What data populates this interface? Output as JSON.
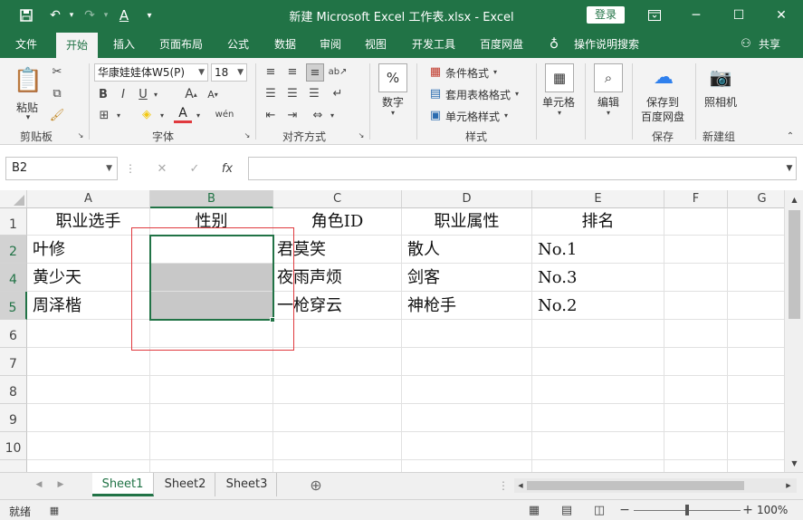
{
  "titlebar": {
    "title": "新建 Microsoft Excel 工作表.xlsx  -  Excel",
    "login_label": "登录"
  },
  "ribbon_tabs": [
    "文件",
    "开始",
    "插入",
    "页面布局",
    "公式",
    "数据",
    "审阅",
    "视图",
    "开发工具",
    "百度网盘",
    "操作说明搜索",
    "共享"
  ],
  "ribbon": {
    "paste_label": "粘贴",
    "clipboard_group": "剪贴板",
    "font_name": "华康娃娃体W5(P)",
    "font_size": "18",
    "font_group": "字体",
    "bold": "B",
    "italic": "I",
    "underline": "U",
    "align_group": "对齐方式",
    "number_label": "数字",
    "conditional_format": "条件格式",
    "table_format": "套用表格格式",
    "cell_style": "单元格样式",
    "style_group": "样式",
    "cells_label": "单元格",
    "edit_label": "编辑",
    "save_baidu_line1": "保存到",
    "save_baidu_line2": "百度网盘",
    "save_group": "保存",
    "camera_label": "照相机",
    "new_group": "新建组"
  },
  "formula_bar": {
    "name_box": "B2",
    "fx": "fx",
    "formula": ""
  },
  "columns": [
    "A",
    "B",
    "C",
    "D",
    "E",
    "F",
    "G"
  ],
  "rows": [
    "1",
    "2",
    "4",
    "5",
    "6",
    "7",
    "8",
    "9",
    "10"
  ],
  "cells": {
    "r1": [
      "职业选手",
      "性别",
      "角色ID",
      "职业属性",
      "排名"
    ],
    "r2": [
      "叶修",
      "",
      "君莫笑",
      "散人",
      "No.1"
    ],
    "r4": [
      "黄少天",
      "",
      "夜雨声烦",
      "剑客",
      "No.3"
    ],
    "r5": [
      "周泽楷",
      "",
      "一枪穿云",
      "神枪手",
      "No.2"
    ]
  },
  "sheets": [
    "Sheet1",
    "Sheet2",
    "Sheet3"
  ],
  "status": {
    "ready": "就绪",
    "zoom": "100%"
  }
}
